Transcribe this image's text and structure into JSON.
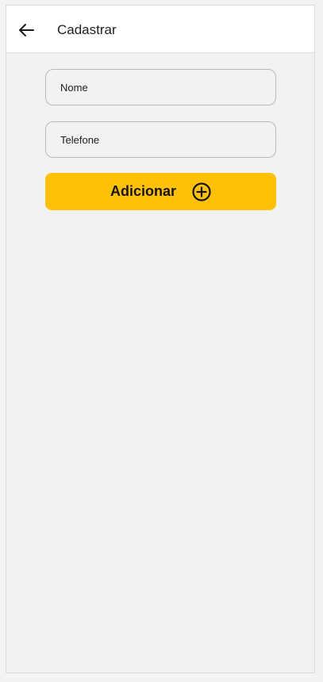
{
  "appbar": {
    "title": "Cadastrar",
    "back_icon": "arrow-left-icon"
  },
  "form": {
    "name_placeholder": "Nome",
    "phone_placeholder": "Telefone",
    "name_value": "",
    "phone_value": ""
  },
  "actions": {
    "add_label": "Adicionar",
    "add_icon": "plus-circle-icon",
    "add_color": "#ffc107"
  }
}
